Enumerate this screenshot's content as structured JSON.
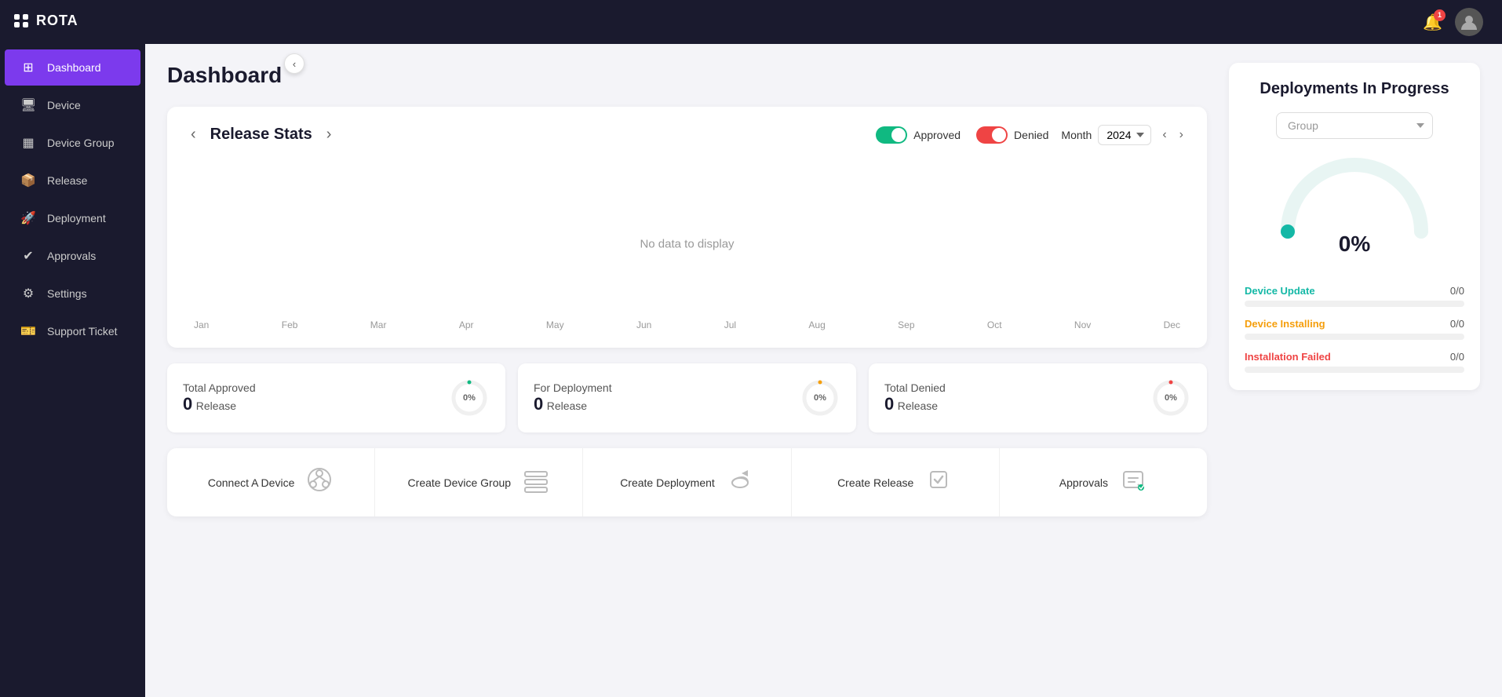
{
  "app": {
    "name": "ROTA",
    "notification_badge": "1"
  },
  "sidebar": {
    "collapse_icon": "‹",
    "items": [
      {
        "id": "dashboard",
        "label": "Dashboard",
        "active": true,
        "icon": "⊞"
      },
      {
        "id": "device",
        "label": "Device",
        "active": false,
        "icon": "🖥"
      },
      {
        "id": "device-group",
        "label": "Device Group",
        "active": false,
        "icon": "▦"
      },
      {
        "id": "release",
        "label": "Release",
        "active": false,
        "icon": "📦"
      },
      {
        "id": "deployment",
        "label": "Deployment",
        "active": false,
        "icon": "🚀"
      },
      {
        "id": "approvals",
        "label": "Approvals",
        "active": false,
        "icon": "✔"
      },
      {
        "id": "settings",
        "label": "Settings",
        "active": false,
        "icon": "⚙"
      },
      {
        "id": "support-ticket",
        "label": "Support Ticket",
        "active": false,
        "icon": "🎫"
      }
    ]
  },
  "dashboard": {
    "title": "Dashboard",
    "release_stats": {
      "title": "Release Stats",
      "approved_label": "Approved",
      "denied_label": "Denied",
      "month_label": "Month",
      "year": "2024",
      "no_data_text": "No data to display",
      "x_axis": [
        "Jan",
        "Feb",
        "Mar",
        "Apr",
        "May",
        "Jun",
        "Jul",
        "Aug",
        "Sep",
        "Oct",
        "Nov",
        "Dec"
      ]
    },
    "summary_cards": [
      {
        "label": "Total Approved",
        "count": "0",
        "unit": "Release",
        "percent": "0%"
      },
      {
        "label": "For Deployment",
        "count": "0",
        "unit": "Release",
        "percent": "0%"
      },
      {
        "label": "Total Denied",
        "count": "0",
        "unit": "Release",
        "percent": "0%"
      }
    ],
    "quick_actions": [
      {
        "id": "connect-device",
        "label": "Connect A Device",
        "icon": "◎"
      },
      {
        "id": "create-device-group",
        "label": "Create Device Group",
        "icon": "▦"
      },
      {
        "id": "create-deployment",
        "label": "Create Deployment",
        "icon": "🚀"
      },
      {
        "id": "create-release",
        "label": "Create Release",
        "icon": "📦"
      },
      {
        "id": "approvals",
        "label": "Approvals",
        "icon": "✔"
      }
    ]
  },
  "deployments_panel": {
    "title": "Deployments In Progress",
    "group_placeholder": "Group",
    "gauge_percent": "0%",
    "progress_items": [
      {
        "id": "device-update",
        "label": "Device Update",
        "value": "0/0",
        "color": "teal",
        "fill_percent": 0
      },
      {
        "id": "device-installing",
        "label": "Device Installing",
        "value": "0/0",
        "color": "amber",
        "fill_percent": 0
      },
      {
        "id": "installation-failed",
        "label": "Installation Failed",
        "value": "0/0",
        "color": "red",
        "fill_percent": 0
      }
    ]
  }
}
